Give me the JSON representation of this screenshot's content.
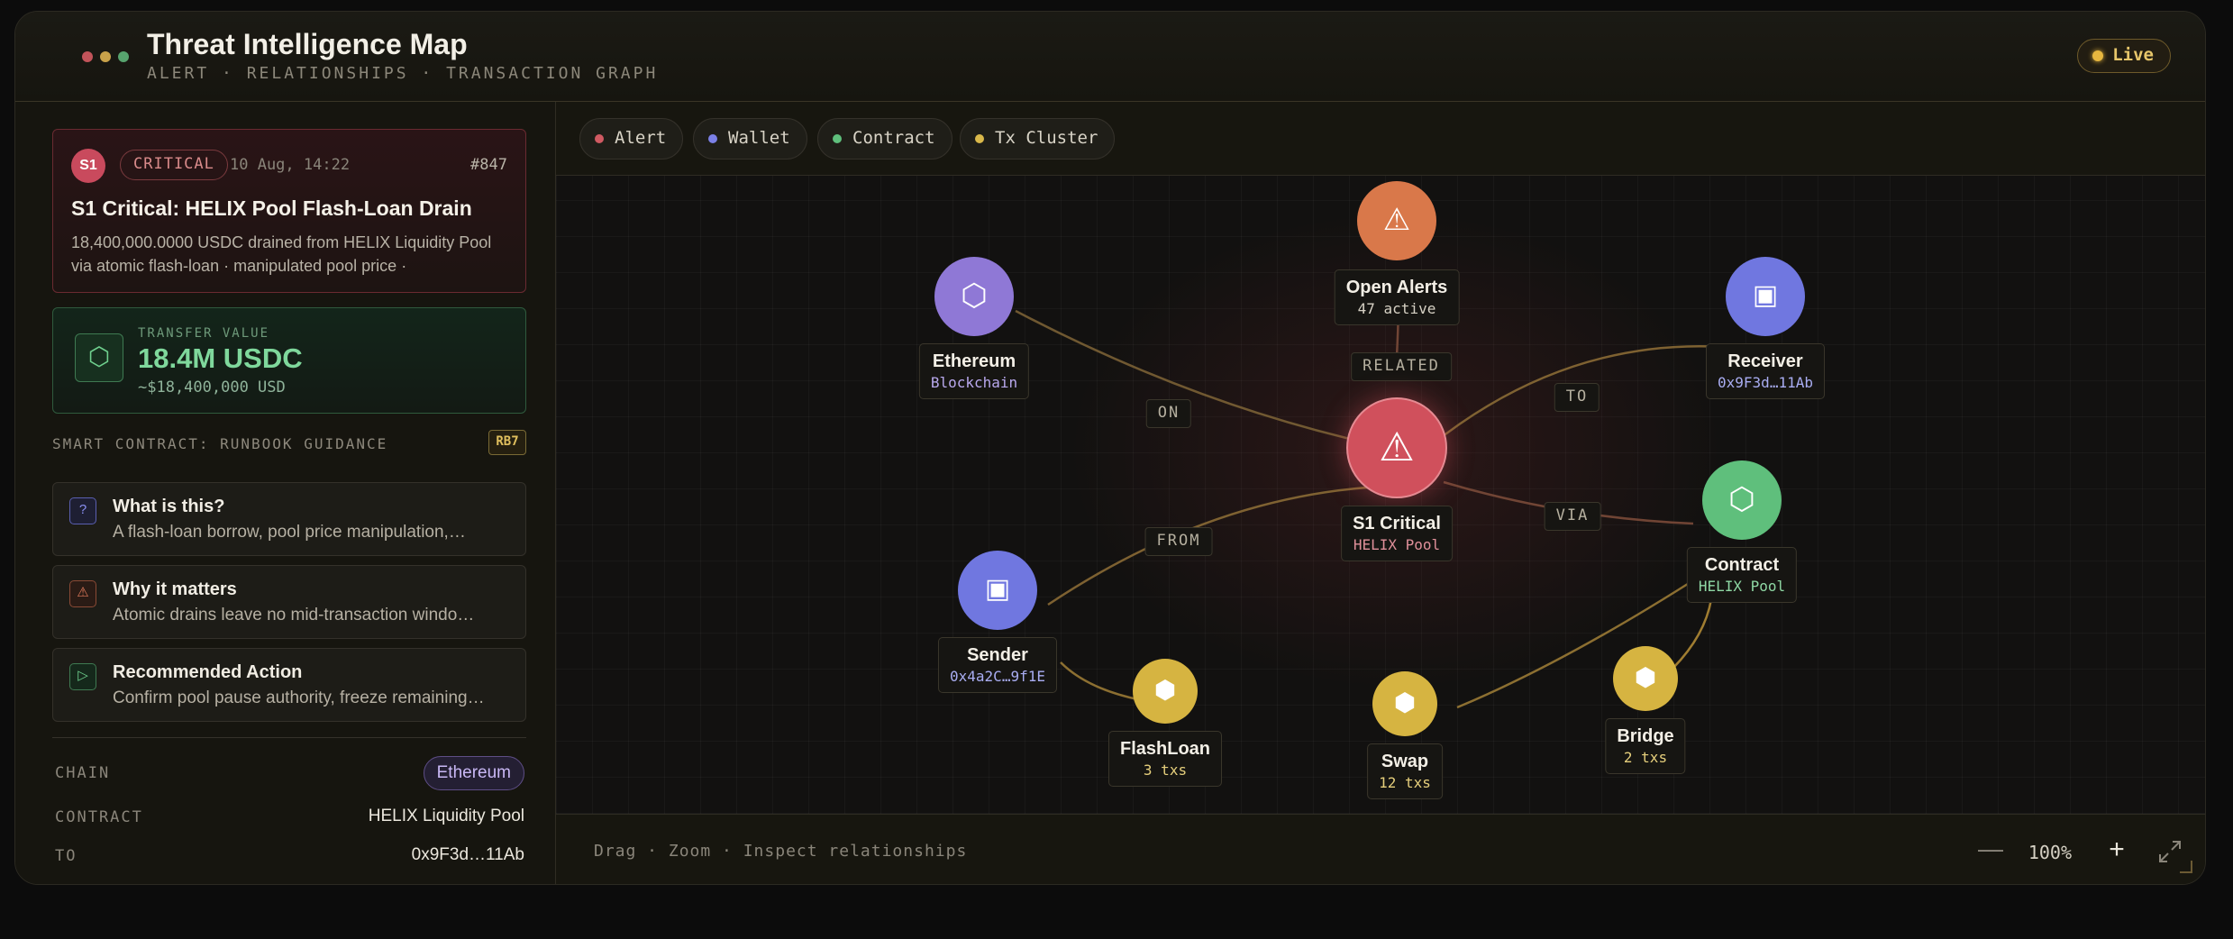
{
  "header": {
    "title": "Threat Intelligence Map",
    "subtitle": "ALERT · RELATIONSHIPS · TRANSACTION GRAPH",
    "live_label": "Live"
  },
  "alert": {
    "severity": "S1",
    "level": "CRITICAL",
    "time": "10 Aug, 14:22",
    "id": "#847",
    "title": "S1 Critical: HELIX Pool Flash-Loan Drain",
    "description": "18,400,000.0000 USDC drained from HELIX Liquidity Pool via atomic flash-loan · manipulated pool price ·"
  },
  "transfer": {
    "label": "TRANSFER VALUE",
    "amount": "18.4M USDC",
    "usd": "~$18,400,000 USD"
  },
  "runbook": {
    "heading": "SMART CONTRACT: RUNBOOK GUIDANCE",
    "badge": "RB7",
    "items": [
      {
        "title": "What is this?",
        "text": "A flash-loan borrow, pool price manipulation,…",
        "icon": "question-icon"
      },
      {
        "title": "Why it matters",
        "text": "Atomic drains leave no mid-transaction windo…",
        "icon": "warning-icon"
      },
      {
        "title": "Recommended Action",
        "text": "Confirm pool pause authority, freeze remaining…",
        "icon": "play-icon"
      }
    ]
  },
  "meta": {
    "chain_label": "CHAIN",
    "chain_value": "Ethereum",
    "contract_label": "CONTRACT",
    "contract_value": "HELIX Liquidity Pool",
    "to_label": "TO",
    "to_value": "0x9F3d…11Ab"
  },
  "legend": [
    {
      "label": "Alert",
      "color": "#d05a62"
    },
    {
      "label": "Wallet",
      "color": "#7b80e6"
    },
    {
      "label": "Contract",
      "color": "#5fbf7c"
    },
    {
      "label": "Tx Cluster",
      "color": "#d9b84a"
    }
  ],
  "graph": {
    "nodes": {
      "open_alerts": {
        "name": "Open Alerts",
        "sub": "47 active",
        "icon": "warning-icon"
      },
      "ethereum": {
        "name": "Ethereum",
        "sub": "Blockchain",
        "icon": "hexagon-icon"
      },
      "receiver": {
        "name": "Receiver",
        "sub": "0x9F3d…11Ab",
        "icon": "wallet-icon"
      },
      "critical": {
        "name": "S1 Critical",
        "sub": "HELIX Pool",
        "icon": "warning-icon"
      },
      "contract": {
        "name": "Contract",
        "sub": "HELIX Pool",
        "icon": "hexagon-icon"
      },
      "sender": {
        "name": "Sender",
        "sub": "0x4a2C…9f1E",
        "icon": "wallet-icon"
      },
      "flashloan": {
        "name": "FlashLoan",
        "sub": "3 txs",
        "icon": "cube-icon"
      },
      "swap": {
        "name": "Swap",
        "sub": "12 txs",
        "icon": "cube-icon"
      },
      "bridge": {
        "name": "Bridge",
        "sub": "2 txs",
        "icon": "cube-icon"
      }
    },
    "edge_labels": {
      "on": "ON",
      "related": "RELATED",
      "to": "TO",
      "via": "VIA",
      "from": "FROM"
    }
  },
  "footer": {
    "hint": "Drag · Zoom · Inspect relationships",
    "zoom_out": "—",
    "zoom_level": "100%",
    "zoom_in": "+"
  }
}
